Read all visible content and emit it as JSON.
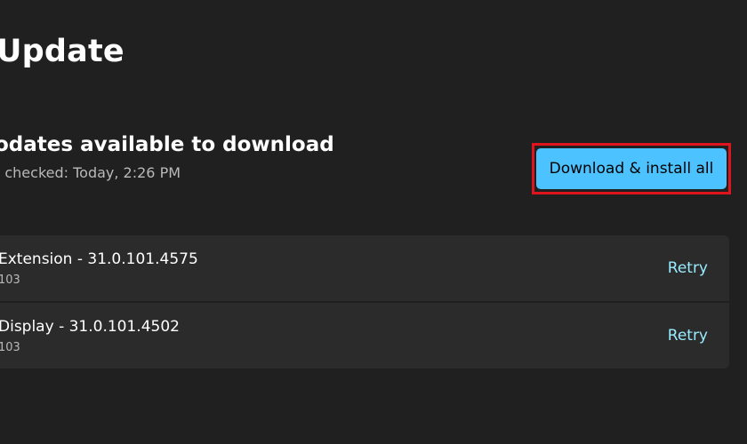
{
  "header": {
    "title": "Update"
  },
  "status": {
    "heading": "odates available to download",
    "subtitle": "t checked: Today, 2:26 PM",
    "action_label": "Download & install all"
  },
  "updates": [
    {
      "title": "Extension - 31.0.101.4575",
      "subtitle": "103",
      "action_label": "Retry"
    },
    {
      "title": "Display - 31.0.101.4502",
      "subtitle": "103",
      "action_label": "Retry"
    }
  ],
  "colors": {
    "background": "#202020",
    "card": "#2b2b2b",
    "accent_button": "#4cc2ff",
    "link": "#99ebff",
    "highlight_border": "#e0141c",
    "secondary_text": "#b9b9b9"
  }
}
